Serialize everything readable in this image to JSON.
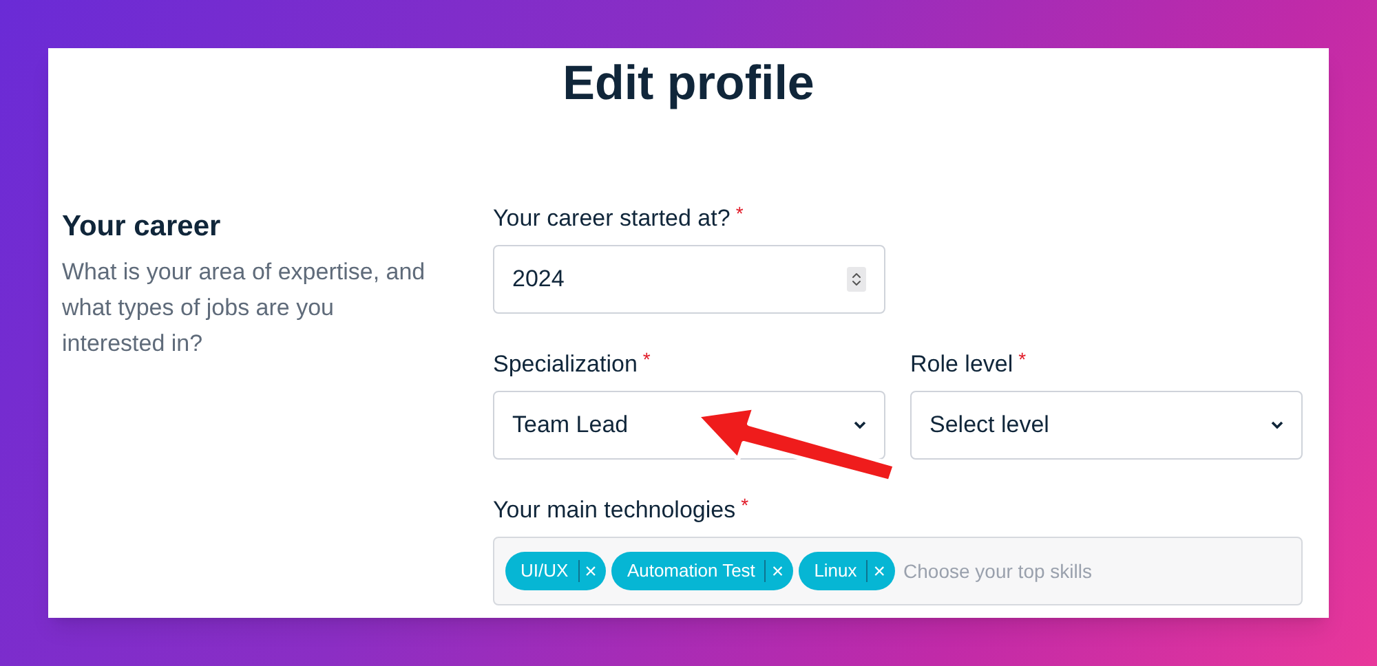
{
  "page": {
    "title": "Edit profile"
  },
  "section": {
    "title": "Your career",
    "description": "What is your area of expertise, and what types of jobs are you interested in?"
  },
  "career_start": {
    "label": "Your career started at?",
    "required_mark": "*",
    "value": "2024"
  },
  "specialization": {
    "label": "Specialization",
    "required_mark": "*",
    "value": "Team Lead"
  },
  "role_level": {
    "label": "Role level",
    "required_mark": "*",
    "value": "Select level"
  },
  "technologies": {
    "label": "Your main technologies",
    "required_mark": "*",
    "placeholder": "Choose your top skills",
    "tags": [
      {
        "label": "UI/UX",
        "remove": "×"
      },
      {
        "label": "Automation Test",
        "remove": "×"
      },
      {
        "label": "Linux",
        "remove": "×"
      }
    ]
  }
}
